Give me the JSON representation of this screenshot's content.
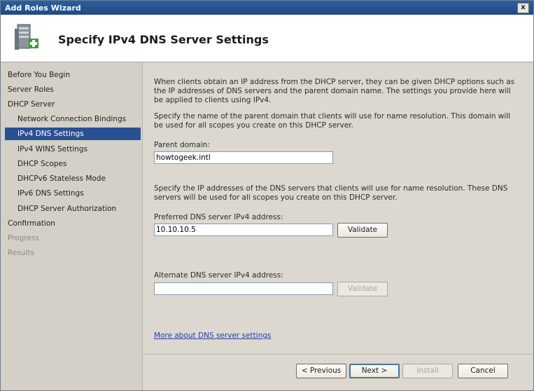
{
  "window": {
    "title": "Add Roles Wizard",
    "close_label": "x"
  },
  "header": {
    "title": "Specify IPv4 DNS Server Settings",
    "icon": "server-add-icon"
  },
  "sidebar": {
    "items": [
      {
        "label": "Before You Begin",
        "state": "normal"
      },
      {
        "label": "Server Roles",
        "state": "normal"
      },
      {
        "label": "DHCP Server",
        "state": "normal"
      },
      {
        "label": "Network Connection Bindings",
        "state": "sub"
      },
      {
        "label": "IPv4 DNS Settings",
        "state": "active"
      },
      {
        "label": "IPv4 WINS Settings",
        "state": "sub"
      },
      {
        "label": "DHCP Scopes",
        "state": "sub"
      },
      {
        "label": "DHCPv6 Stateless Mode",
        "state": "sub"
      },
      {
        "label": "IPv6 DNS Settings",
        "state": "sub"
      },
      {
        "label": "DHCP Server Authorization",
        "state": "sub"
      },
      {
        "label": "Confirmation",
        "state": "normal"
      },
      {
        "label": "Progress",
        "state": "disabled"
      },
      {
        "label": "Results",
        "state": "disabled"
      }
    ]
  },
  "main": {
    "intro": "When clients obtain an IP address from the DHCP server, they can be given DHCP options such as the IP addresses of DNS servers and the parent domain name. The settings you provide here will be applied to clients using IPv4.",
    "domain_instructions": "Specify the name of the parent domain that clients will use for name resolution. This domain will be used for all scopes you create on this DHCP server.",
    "parent_domain_label": "Parent domain:",
    "parent_domain_value": "howtogeek.intl",
    "dns_instructions": "Specify the IP addresses of the DNS servers that clients will use for name resolution. These DNS servers will be used for all scopes you create on this DHCP server.",
    "preferred_label": "Preferred DNS server IPv4 address:",
    "preferred_value": "10.10.10.5",
    "validate_label": "Validate",
    "alternate_label": "Alternate DNS server IPv4 address:",
    "alternate_value": "",
    "validate_alt_label": "Validate",
    "more_link": "More about DNS server settings"
  },
  "footer": {
    "previous_label": "< Previous",
    "next_label": "Next >",
    "install_label": "Install",
    "cancel_label": "Cancel"
  }
}
